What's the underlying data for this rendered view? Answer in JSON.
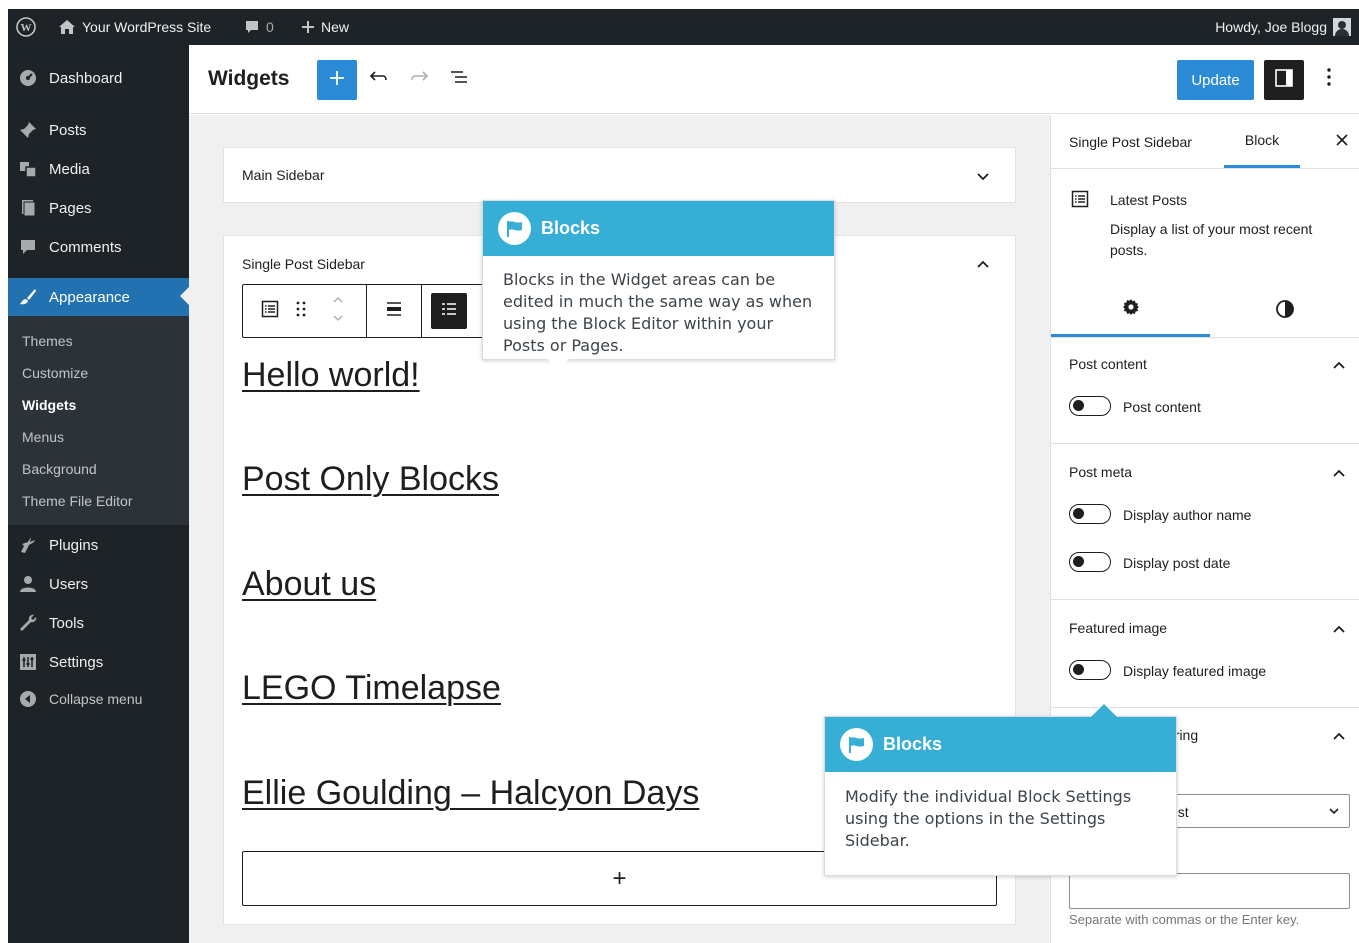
{
  "admin_bar": {
    "site_name": "Your WordPress Site",
    "comment_count": "0",
    "new_label": "New",
    "howdy": "Howdy, Joe Blogg"
  },
  "menu": {
    "dashboard": "Dashboard",
    "posts": "Posts",
    "media": "Media",
    "pages": "Pages",
    "comments": "Comments",
    "appearance": "Appearance",
    "submenu": [
      "Themes",
      "Customize",
      "Widgets",
      "Menus",
      "Background",
      "Theme File Editor"
    ],
    "plugins": "Plugins",
    "users": "Users",
    "tools": "Tools",
    "settings": "Settings",
    "collapse": "Collapse menu"
  },
  "header": {
    "title": "Widgets",
    "update_label": "Update"
  },
  "canvas": {
    "main_sidebar_title": "Main Sidebar",
    "single_post_sidebar_title": "Single Post Sidebar",
    "posts": [
      "Hello world!",
      "Post Only Blocks",
      "About us",
      "LEGO Timelapse",
      "Ellie Goulding – Halcyon Days"
    ],
    "appender_symbol": "+"
  },
  "settings": {
    "tab_area": "Single Post Sidebar",
    "tab_block": "Block",
    "block_title": "Latest Posts",
    "block_description": "Display a list of your most recent posts.",
    "post_content": {
      "title": "Post content",
      "toggle_label": "Post content"
    },
    "post_meta": {
      "title": "Post meta",
      "author_label": "Display author name",
      "date_label": "Display post date"
    },
    "featured_image": {
      "title": "Featured image",
      "toggle_label": "Display featured image"
    },
    "sorting_partial": "ering",
    "order_value_partial": "est",
    "help_text": "Separate with commas or the Enter key."
  },
  "callouts": {
    "first": {
      "title": "Blocks",
      "body": "Blocks in the Widget areas can be edited in much the same way as when using the Block Editor within your Posts or Pages."
    },
    "second": {
      "title": "Blocks",
      "body": "Modify the individual Block Settings using the options in the Settings Sidebar."
    }
  },
  "colors": {
    "admin_dark": "#1d2327",
    "accent_blue": "#2b8bd6",
    "callout_blue": "#36aed5"
  }
}
